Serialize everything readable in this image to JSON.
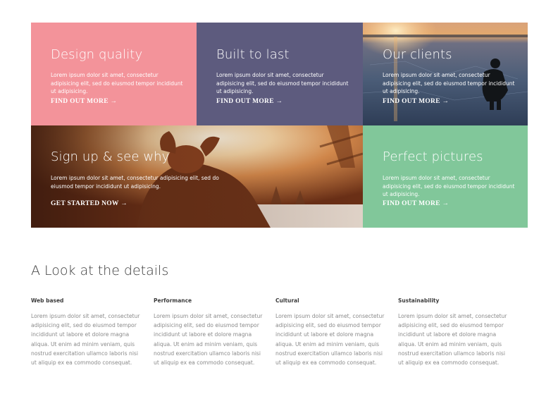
{
  "tiles": [
    {
      "title": "Design quality",
      "desc": "Lorem ipsum dolor sit amet, consectetur adipisicing elit, sed do eiusmod tempor incididunt ut adipisicing.",
      "cta": "FIND OUT MORE →",
      "color": "#f3939a"
    },
    {
      "title": "Built to last",
      "desc": "Lorem ipsum dolor sit amet, consectetur adipisicing elit, sed do eiusmod tempor incididunt ut adipisicing.",
      "cta": "FIND OUT MORE →",
      "color": "#5d5b7e"
    },
    {
      "title": "Our clients",
      "desc": "Lorem ipsum dolor sit amet, consectetur adipisicing elit, sed do eiusmod tempor incididunt ut adipisicing.",
      "cta": "FIND OUT MORE →",
      "image": "photographer-on-frozen-lake-at-sunset"
    },
    {
      "title": "Sign up & see why",
      "desc": "Lorem ipsum dolor sit amet, consectetur adipisicing elit, sed do eiusmod tempor incididunt ut adipisicing.",
      "cta": "GET STARTED NOW →",
      "image": "person-shielding-eyes-in-winter-sun"
    },
    {
      "title": "Perfect pictures",
      "desc": "Lorem ipsum dolor sit amet, consectetur adipisicing elit, sed do eiusmod tempor incididunt ut adipisicing.",
      "cta": "FIND OUT MORE →",
      "color": "#81c79a"
    }
  ],
  "details": {
    "title": "A Look at the details",
    "columns": [
      {
        "heading": "Web based",
        "text": "Lorem ipsum dolor sit amet, consectetur adipisicing elit, sed do eiusmod tempor incididunt ut labore et dolore magna aliqua. Ut enim ad minim veniam, quis nostrud exercitation ullamco laboris nisi ut aliquip ex ea commodo consequat."
      },
      {
        "heading": "Performance",
        "text": "Lorem ipsum dolor sit amet, consectetur adipisicing elit, sed do eiusmod tempor incididunt ut labore et dolore magna aliqua. Ut enim ad minim veniam, quis nostrud exercitation ullamco laboris nisi ut aliquip ex ea commodo consequat."
      },
      {
        "heading": "Cultural",
        "text": "Lorem ipsum dolor sit amet, consectetur adipisicing elit, sed do eiusmod tempor incididunt ut labore et dolore magna aliqua. Ut enim ad minim veniam, quis nostrud exercitation ullamco laboris nisi ut aliquip ex ea commodo consequat."
      },
      {
        "heading": "Sustainability",
        "text": "Lorem ipsum dolor sit amet, consectetur adipisicing elit, sed do eiusmod tempor incididunt ut labore et dolore magna aliqua. Ut enim ad minim veniam, quis nostrud exercitation ullamco laboris nisi ut aliquip ex ea commodo consequat."
      }
    ]
  }
}
